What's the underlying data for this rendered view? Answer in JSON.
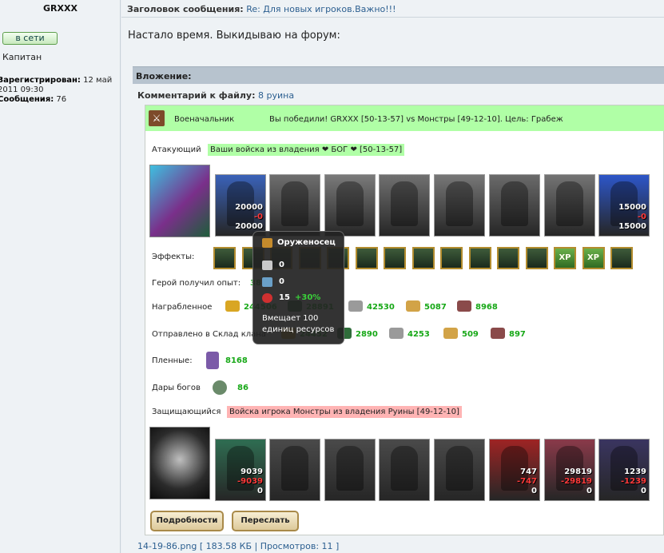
{
  "profile": {
    "username": "GRXXX",
    "online_badge": "в сети",
    "rank": "Капитан",
    "registered_label": "Зарегистрирован:",
    "registered_value": "12 май 2011 09:30",
    "posts_label": "Сообщения:",
    "posts_value": "76"
  },
  "post": {
    "subject_label": "Заголовок сообщения:",
    "subject_value": "Re: Для новых игроков.Важно!!!",
    "text": "Настало время. Выкидываю на форум:",
    "attachment_header": "Вложение:",
    "comment_label": "Комментарий к файлу:",
    "comment_value": "8 руина",
    "file_info": "14-19-86.png [ 183.58 КБ | Просмотров: 11 ]"
  },
  "report": {
    "class_label": "Военачальник",
    "result_text": "Вы победили! GRXXX [50-13-57] vs Монстры [49-12-10]. Цель: Грабеж",
    "attacker_label": "Атакующий",
    "attacker_tag": "Ваши войска из владения ❤ БОГ ❤ [50-13-57]",
    "attacker_units": [
      {
        "v1": "20000",
        "v2": "-0",
        "v3": "20000",
        "color": "#3a62b8"
      },
      {
        "v1": "",
        "v2": "",
        "v3": "",
        "color": "#6e6e6e"
      },
      {
        "v1": "",
        "v2": "",
        "v3": "",
        "color": "#7a7a7a"
      },
      {
        "v1": "",
        "v2": "",
        "v3": "",
        "color": "#707070"
      },
      {
        "v1": "",
        "v2": "",
        "v3": "",
        "color": "#777777"
      },
      {
        "v1": "",
        "v2": "",
        "v3": "",
        "color": "#6a6a6a"
      },
      {
        "v1": "",
        "v2": "",
        "v3": "",
        "color": "#747474"
      },
      {
        "v1": "15000",
        "v2": "-0",
        "v3": "15000",
        "color": "#2d56c8"
      }
    ],
    "effects_label": "Эффекты:",
    "effects": [
      "",
      "",
      "",
      "",
      "",
      "",
      "",
      "",
      "",
      "",
      "",
      "",
      "XP",
      "XP",
      ""
    ],
    "exp_label": "Герой получил опыт:",
    "exp_value": "38",
    "loot_label": "Награбленное",
    "loot": [
      "244506",
      "28891",
      "42530",
      "5087",
      "8968"
    ],
    "sent_label": "Отправлено в Склад клана",
    "sent": [
      "24452",
      "2890",
      "4253",
      "509",
      "897"
    ],
    "captives_label": "Пленные:",
    "captives_value": "8168",
    "gifts_label": "Дары богов",
    "gifts_value": "86",
    "defender_label": "Защищающийся",
    "defender_tag": "Войска игрока Монстры из владения Руины [49-12-10]",
    "defender_units": [
      {
        "v1": "9039",
        "v2": "-9039",
        "v3": "0",
        "color": "#2f6d52"
      },
      {
        "v1": "",
        "v2": "",
        "v3": "",
        "color": "#4a4a4a"
      },
      {
        "v1": "",
        "v2": "",
        "v3": "",
        "color": "#4a4a4a"
      },
      {
        "v1": "",
        "v2": "",
        "v3": "",
        "color": "#4a4a4a"
      },
      {
        "v1": "",
        "v2": "",
        "v3": "",
        "color": "#4a4a4a"
      },
      {
        "v1": "747",
        "v2": "-747",
        "v3": "0",
        "color": "#9e2424"
      },
      {
        "v1": "29819",
        "v2": "-29819",
        "v3": "0",
        "color": "#8a3a4a"
      },
      {
        "v1": "1239",
        "v2": "-1239",
        "v3": "0",
        "color": "#3a3560"
      }
    ],
    "details_button": "Подробности",
    "forward_button": "Переслать"
  },
  "tooltip": {
    "title": "Оруженосец",
    "attack": "0",
    "defense": "0",
    "health": "15",
    "health_bonus": "+30%",
    "description": "Вмещает 100 единиц ресурсов"
  }
}
